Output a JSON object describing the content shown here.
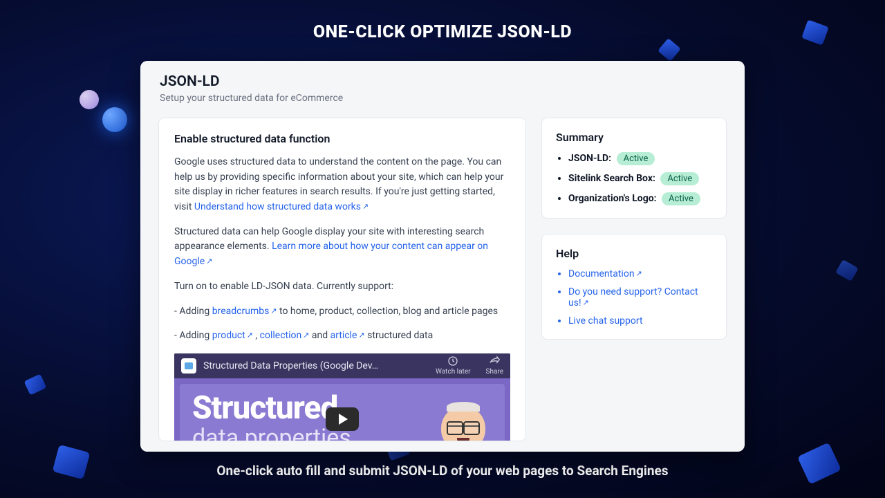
{
  "banner": {
    "title": "ONE-CLICK OPTIMIZE JSON-LD",
    "subtitle": "One-click auto fill and submit JSON-LD of your web pages to Search Engines"
  },
  "page": {
    "title": "JSON-LD",
    "subtitle": "Setup your structured data for eCommerce"
  },
  "main": {
    "heading": "Enable structured data function",
    "p1_a": "Google uses structured data to understand the content on the page. You can help us by providing specific information about your site, which can help your site display in richer features in search results. If you're just getting started, visit ",
    "p1_link": "Understand how structured data works",
    "p2_a": "Structured data can help Google display your site with interesting search appearance elements. ",
    "p2_link": "Learn more about how your content can appear on Google",
    "p3": "Turn on to enable LD-JSON data. Currently support:",
    "l1_a": "- Adding ",
    "l1_link": "breadcrumbs",
    "l1_b": "  to home, product, collection, blog and article pages",
    "l2_a": "- Adding ",
    "l2_link1": "product",
    "l2_sep": " , ",
    "l2_link2": "collection",
    "l2_and": "  and ",
    "l2_link3": "article",
    "l2_b": "  structured data"
  },
  "video": {
    "title": "Structured Data Properties (Google Dev…",
    "watch_later": "Watch later",
    "share": "Share",
    "line1": "Structured",
    "line2": "data properties"
  },
  "summary": {
    "heading": "Summary",
    "items": [
      {
        "label": "JSON-LD:",
        "status": "Active"
      },
      {
        "label": "Sitelink Search Box:",
        "status": "Active"
      },
      {
        "label": "Organization's Logo:",
        "status": "Active"
      }
    ]
  },
  "help": {
    "heading": "Help",
    "items": [
      "Documentation",
      "Do you need support? Contact us!",
      "Live chat support"
    ]
  }
}
